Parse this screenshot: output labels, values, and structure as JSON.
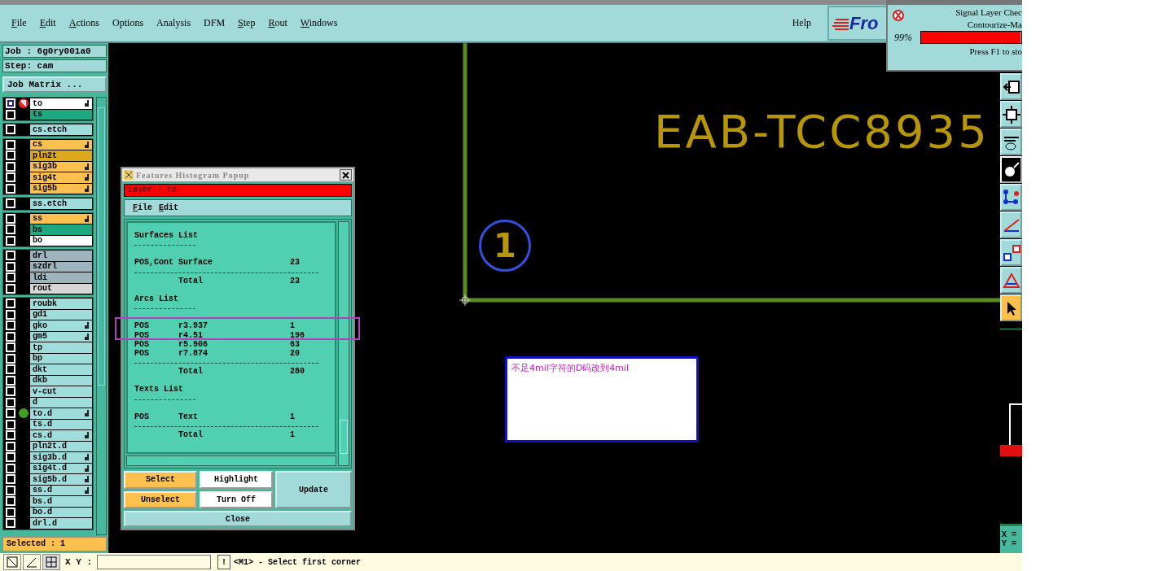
{
  "menu_bar": {
    "items": [
      {
        "label": "File",
        "underline": true
      },
      {
        "label": "Edit",
        "underline": true
      },
      {
        "label": "Actions",
        "underline": true
      },
      {
        "label": "Options",
        "underline": false
      },
      {
        "label": "Analysis",
        "underline": false
      },
      {
        "label": "DFM",
        "underline": false
      },
      {
        "label": "Step",
        "underline": true
      },
      {
        "label": "Rout",
        "underline": true
      },
      {
        "label": "Windows",
        "underline": true
      }
    ],
    "help": "Help",
    "logo_text": "Fro"
  },
  "progress": {
    "lines": [
      "Signal Layer Chec",
      "Contourize-Ma"
    ],
    "percent": "99%",
    "level": 0.99,
    "hint": "Press F1 to sto"
  },
  "job_panel": {
    "job": "Job : 6g0ry001a0",
    "step": "Step: cam",
    "matrix_button": "Job Matrix ...",
    "layer_groups": [
      [
        {
          "name": "to",
          "color": "#ffffff",
          "checked": true,
          "hand": true,
          "pointer": true
        },
        {
          "name": "ts",
          "color": "#1ea882",
          "checked": false,
          "hand": false
        }
      ],
      [
        {
          "name": "cs.etch",
          "color": "#9fdcdc",
          "checked": false,
          "hand": false
        }
      ],
      [
        {
          "name": "cs",
          "color": "#fcc04e",
          "checked": false,
          "hand": true
        },
        {
          "name": "pln2t",
          "color": "#dca81c",
          "checked": false,
          "hand": false
        },
        {
          "name": "sig3b",
          "color": "#fcc04e",
          "checked": false,
          "hand": true
        },
        {
          "name": "sig4t",
          "color": "#fcc04e",
          "checked": false,
          "hand": true
        },
        {
          "name": "sig5b",
          "color": "#fcc04e",
          "checked": false,
          "hand": true
        }
      ],
      [
        {
          "name": "ss.etch",
          "color": "#9fdcdc",
          "checked": false,
          "hand": false
        }
      ],
      [
        {
          "name": "ss",
          "color": "#fcc04e",
          "checked": false,
          "hand": true
        },
        {
          "name": "bs",
          "color": "#1ea882",
          "checked": false,
          "hand": false
        },
        {
          "name": "bo",
          "color": "#ffffff",
          "checked": false,
          "hand": false
        }
      ],
      [
        {
          "name": "drl",
          "color": "#9db4bc",
          "checked": false,
          "hand": false
        },
        {
          "name": "szdrl",
          "color": "#9db4bc",
          "checked": false,
          "hand": false
        },
        {
          "name": "ldi",
          "color": "#9db4bc",
          "checked": false,
          "hand": false
        },
        {
          "name": "rout",
          "color": "#d6d6d6",
          "checked": false,
          "hand": false
        }
      ],
      [
        {
          "name": "roubk",
          "color": "#9fdcdc",
          "checked": false,
          "hand": false
        },
        {
          "name": "gd1",
          "color": "#9fdcdc",
          "checked": false,
          "hand": false
        },
        {
          "name": "gko",
          "color": "#9fdcdc",
          "checked": false,
          "hand": true
        },
        {
          "name": "gm5",
          "color": "#9fdcdc",
          "checked": false,
          "hand": true
        },
        {
          "name": "tp",
          "color": "#9fdcdc",
          "checked": false,
          "hand": false
        },
        {
          "name": "bp",
          "color": "#9fdcdc",
          "checked": false,
          "hand": false
        },
        {
          "name": "dkt",
          "color": "#9fdcdc",
          "checked": false,
          "hand": false
        },
        {
          "name": "dkb",
          "color": "#9fdcdc",
          "checked": false,
          "hand": false
        },
        {
          "name": "v-cut",
          "color": "#9fdcdc",
          "checked": false,
          "hand": false
        },
        {
          "name": "d",
          "color": "#9fdcdc",
          "checked": false,
          "hand": false
        },
        {
          "name": "to.d",
          "color": "#9fdcdc",
          "checked": false,
          "hand": true,
          "dot": true
        },
        {
          "name": "ts.d",
          "color": "#9fdcdc",
          "checked": false,
          "hand": false
        },
        {
          "name": "cs.d",
          "color": "#9fdcdc",
          "checked": false,
          "hand": true
        },
        {
          "name": "pln2t.d",
          "color": "#9fdcdc",
          "checked": false,
          "hand": false
        },
        {
          "name": "sig3b.d",
          "color": "#9fdcdc",
          "checked": false,
          "hand": true
        },
        {
          "name": "sig4t.d",
          "color": "#9fdcdc",
          "checked": false,
          "hand": true
        },
        {
          "name": "sig5b.d",
          "color": "#9fdcdc",
          "checked": false,
          "hand": true
        },
        {
          "name": "ss.d",
          "color": "#9fdcdc",
          "checked": false,
          "hand": true
        },
        {
          "name": "bs.d",
          "color": "#9fdcdc",
          "checked": false,
          "hand": false
        },
        {
          "name": "bo.d",
          "color": "#9fdcdc",
          "checked": false,
          "hand": false
        },
        {
          "name": "drl.d",
          "color": "#9fdcdc",
          "checked": false,
          "hand": false
        }
      ]
    ],
    "selected": "Selected : 1"
  },
  "canvas": {
    "board_text": "EAB-TCC8935",
    "marker_label": "1",
    "note": "不足4mil字符的D码改到4mil"
  },
  "popup": {
    "title": "Features Histogram Popup",
    "layer": "Layer :  to",
    "menus": [
      {
        "label": "File",
        "underline": true
      },
      {
        "label": "Edit",
        "underline": true
      }
    ],
    "lines": [
      {
        "kind": "heading",
        "text": "Surfaces List"
      },
      {
        "kind": "blank"
      },
      {
        "kind": "row",
        "cols": [
          "POS,Cont",
          "Surface",
          "23"
        ]
      },
      {
        "kind": "rule"
      },
      {
        "kind": "total",
        "cols": [
          "Total",
          "23"
        ]
      },
      {
        "kind": "blank"
      },
      {
        "kind": "heading",
        "text": "Arcs List"
      },
      {
        "kind": "blank"
      },
      {
        "kind": "row",
        "cols": [
          "POS",
          "r3.937",
          "1"
        ]
      },
      {
        "kind": "row",
        "cols": [
          "POS",
          "r4.51",
          "196"
        ]
      },
      {
        "kind": "row",
        "cols": [
          "POS",
          "r5.906",
          "63"
        ]
      },
      {
        "kind": "row",
        "cols": [
          "POS",
          "r7.874",
          "20"
        ]
      },
      {
        "kind": "rule"
      },
      {
        "kind": "total",
        "cols": [
          "Total",
          "280"
        ]
      },
      {
        "kind": "blank"
      },
      {
        "kind": "heading",
        "text": "Texts List"
      },
      {
        "kind": "blank"
      },
      {
        "kind": "row",
        "cols": [
          "POS",
          "Text",
          "1"
        ]
      },
      {
        "kind": "rule"
      },
      {
        "kind": "total",
        "cols": [
          "Total",
          "1"
        ]
      }
    ],
    "buttons": [
      {
        "label": "Select",
        "color": "#fcc04e"
      },
      {
        "label": "Highlight",
        "color": "#ffffff"
      },
      {
        "label": "Unselect",
        "color": "#fcc04e"
      },
      {
        "label": "Turn Off",
        "color": "#ffffff"
      }
    ],
    "update": "Update",
    "close": "Close"
  },
  "side_panel": {
    "x_label": "X =",
    "y_label": "Y ="
  },
  "status_bar": {
    "xy_label": "X Y :",
    "alert": "!",
    "message": "<M1> - Select first corner"
  }
}
